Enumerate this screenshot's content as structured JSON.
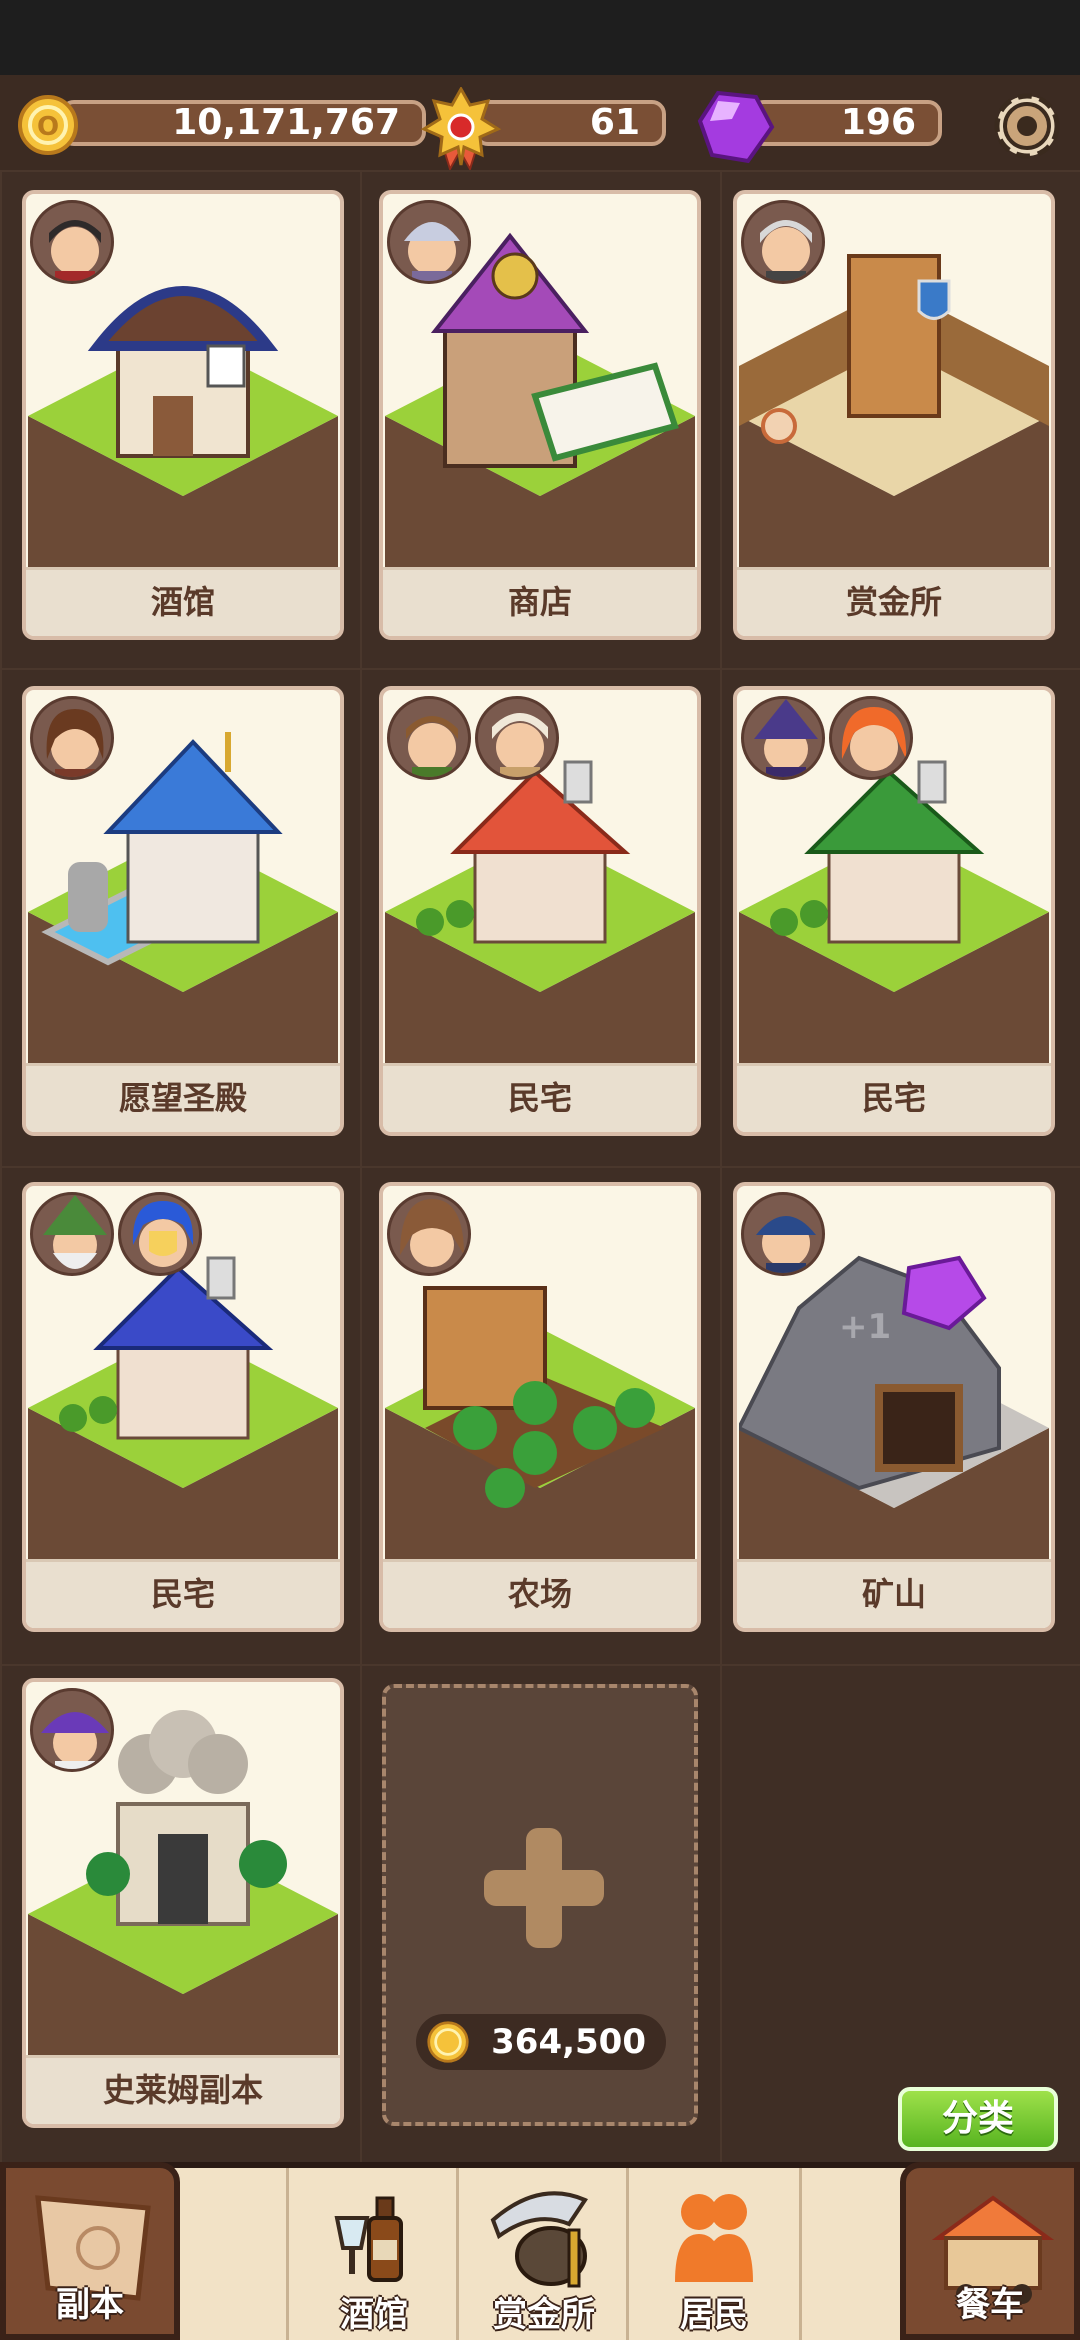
{
  "resources": {
    "gold": "10,171,767",
    "medal": "61",
    "gem": "196"
  },
  "buildings": [
    {
      "name": "酒馆",
      "icon": "tavern-building"
    },
    {
      "name": "商店",
      "icon": "shop-building"
    },
    {
      "name": "赏金所",
      "icon": "bounty-building"
    },
    {
      "name": "愿望圣殿",
      "icon": "wish-temple-building"
    },
    {
      "name": "民宅",
      "icon": "red-roof-house"
    },
    {
      "name": "民宅",
      "icon": "green-roof-house"
    },
    {
      "name": "民宅",
      "icon": "blue-roof-house"
    },
    {
      "name": "农场",
      "icon": "farm-building"
    },
    {
      "name": "矿山",
      "icon": "mine-building",
      "badge": "+1"
    },
    {
      "name": "史莱姆副本",
      "icon": "slime-dungeon-building"
    }
  ],
  "add_slot": {
    "price": "364,500"
  },
  "sort_button": "分类",
  "bottom_nav": {
    "dungeon": "副本",
    "tavern": "酒馆",
    "bounty": "赏金所",
    "residents": "居民",
    "food_cart": "餐车"
  },
  "colors": {
    "accent_green": "#6cc52a",
    "gold": "#f5c23a",
    "gem": "#a43be0"
  }
}
